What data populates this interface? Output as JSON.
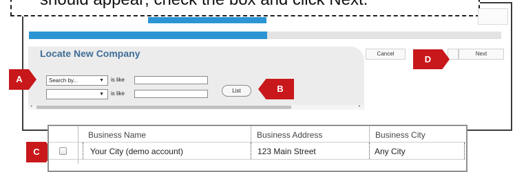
{
  "callout": {
    "text": "should appear; check the box and click Next."
  },
  "progress": {
    "fraction": 0.5
  },
  "locate_panel": {
    "title": "Locate New Company",
    "search_row_1": {
      "selected": "Search by...",
      "operator": "is like",
      "value": ""
    },
    "search_row_2": {
      "selected": "",
      "operator": "is like",
      "value": ""
    },
    "list_button": "List"
  },
  "buttons": {
    "cancel": "Cancel",
    "next": "Next"
  },
  "markers": {
    "a": "A",
    "b": "B",
    "c": "C",
    "d": "D"
  },
  "table": {
    "headers": [
      "Business Name",
      "Business Address",
      "Business City"
    ],
    "rows": [
      {
        "checked": false,
        "name": "Your City (demo account)",
        "address": "123 Main Street",
        "city": "Any City"
      }
    ]
  },
  "colors": {
    "accent_blue": "#2a95d2",
    "marker_red": "#c8181b",
    "title_blue": "#3f6d97"
  },
  "icons": {
    "dropdown": "chevron-down-icon",
    "scroll_left": "arrow-left-icon",
    "scroll_right": "arrow-right-icon"
  }
}
